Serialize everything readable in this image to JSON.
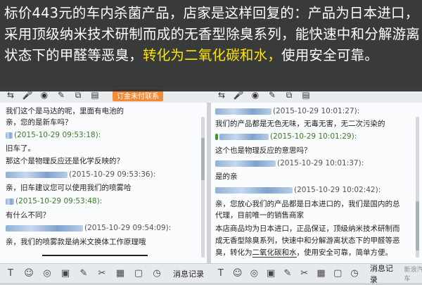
{
  "caption": {
    "part1": "标价443元的车内杀菌产品，店家是这样回复的：产品为日本进口，采用顶级纳米技术研制而成的无香型除臭系列，能快速中和分解游离状态下的甲醛等恶臭，",
    "highlight": "转化为二氧化碳和水，",
    "part2": "使用安全可靠。"
  },
  "left": {
    "tab_label": "订金未付联系",
    "rows": [
      {
        "text": "我们这个是马达的呢，里面有电池的"
      },
      {
        "text": "亲，您的是新车吗？"
      },
      {
        "meta": "(2015-10-29 09:53:18):"
      },
      {
        "text": "旧车了。"
      },
      {
        "text": "那这个是物理反应还是化学反映的？"
      },
      {
        "meta": "(2015-10-29 09:53:36):"
      },
      {
        "text": "亲，旧车建议您可以使用我们的喷雾哈"
      },
      {
        "meta": "(2015-10-29 09:53:48):"
      },
      {
        "text": "有什么不同？"
      },
      {
        "meta": "(2015-10-29 09:54:09):"
      },
      {
        "text": "亲，我们的喷雾款是纳米文换体工作原理哦"
      }
    ],
    "record_label": "消息记录"
  },
  "right": {
    "rows": [
      {
        "meta": "(2015-10-29 10:01:27):"
      },
      {
        "text": "我们的产品都是无色无味，无毒无害，无二次污染的"
      },
      {
        "meta": "(2015-10-29 10:01:29):"
      },
      {
        "text": "这个也是物理反应的意思吗？"
      },
      {
        "meta": "(2015-10-29 10:01:37):"
      },
      {
        "text": "是的亲"
      },
      {
        "meta": "(2015-10-29 10:02:42):"
      },
      {
        "text": "亲，您放心我们的产品都是日本进口的，我们是国内的总"
      },
      {
        "text": "代理，目前唯一的销售商家"
      },
      {
        "text": "本店商品均为日本进口，正品保证，顶级纳米技术研制而"
      },
      {
        "text": "成无香型除臭系列，快速中和分解游离状态下的甲醛等恶"
      },
      {
        "text_a": "臭，转化为",
        "text_u": "二氧化碳和水",
        "text_b": "，使用安全可靠，简单方便。"
      }
    ],
    "record_label": "消息记录",
    "watermark": "新浪汽车"
  }
}
